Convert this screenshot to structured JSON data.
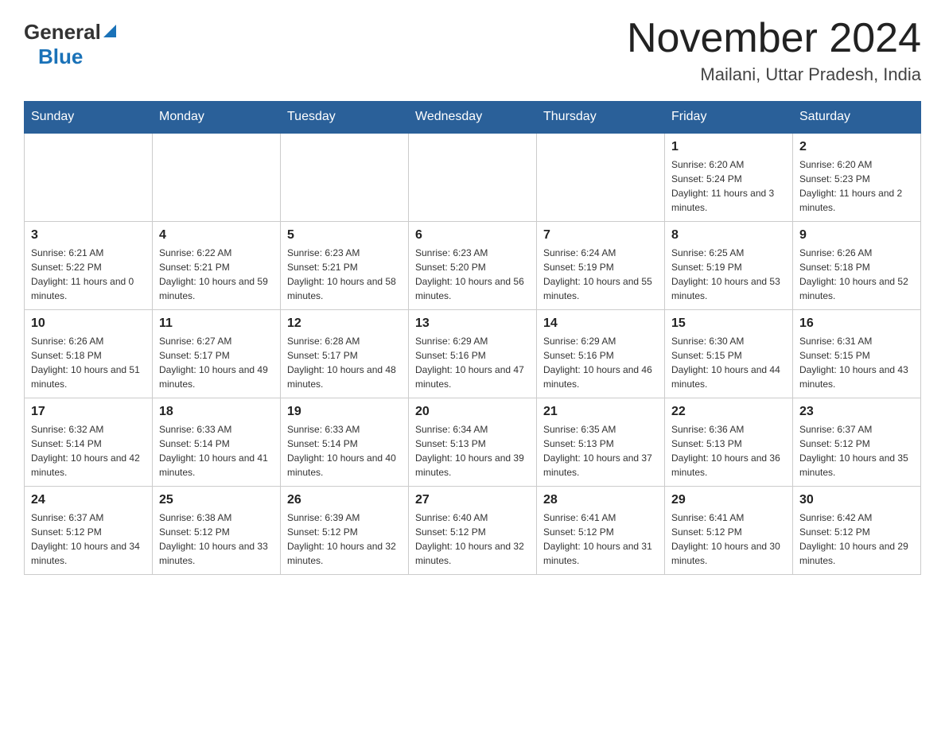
{
  "header": {
    "logo_general": "General",
    "logo_blue": "Blue",
    "title": "November 2024",
    "subtitle": "Mailani, Uttar Pradesh, India"
  },
  "weekdays": [
    "Sunday",
    "Monday",
    "Tuesday",
    "Wednesday",
    "Thursday",
    "Friday",
    "Saturday"
  ],
  "weeks": [
    [
      {
        "day": "",
        "info": ""
      },
      {
        "day": "",
        "info": ""
      },
      {
        "day": "",
        "info": ""
      },
      {
        "day": "",
        "info": ""
      },
      {
        "day": "",
        "info": ""
      },
      {
        "day": "1",
        "info": "Sunrise: 6:20 AM\nSunset: 5:24 PM\nDaylight: 11 hours and 3 minutes."
      },
      {
        "day": "2",
        "info": "Sunrise: 6:20 AM\nSunset: 5:23 PM\nDaylight: 11 hours and 2 minutes."
      }
    ],
    [
      {
        "day": "3",
        "info": "Sunrise: 6:21 AM\nSunset: 5:22 PM\nDaylight: 11 hours and 0 minutes."
      },
      {
        "day": "4",
        "info": "Sunrise: 6:22 AM\nSunset: 5:21 PM\nDaylight: 10 hours and 59 minutes."
      },
      {
        "day": "5",
        "info": "Sunrise: 6:23 AM\nSunset: 5:21 PM\nDaylight: 10 hours and 58 minutes."
      },
      {
        "day": "6",
        "info": "Sunrise: 6:23 AM\nSunset: 5:20 PM\nDaylight: 10 hours and 56 minutes."
      },
      {
        "day": "7",
        "info": "Sunrise: 6:24 AM\nSunset: 5:19 PM\nDaylight: 10 hours and 55 minutes."
      },
      {
        "day": "8",
        "info": "Sunrise: 6:25 AM\nSunset: 5:19 PM\nDaylight: 10 hours and 53 minutes."
      },
      {
        "day": "9",
        "info": "Sunrise: 6:26 AM\nSunset: 5:18 PM\nDaylight: 10 hours and 52 minutes."
      }
    ],
    [
      {
        "day": "10",
        "info": "Sunrise: 6:26 AM\nSunset: 5:18 PM\nDaylight: 10 hours and 51 minutes."
      },
      {
        "day": "11",
        "info": "Sunrise: 6:27 AM\nSunset: 5:17 PM\nDaylight: 10 hours and 49 minutes."
      },
      {
        "day": "12",
        "info": "Sunrise: 6:28 AM\nSunset: 5:17 PM\nDaylight: 10 hours and 48 minutes."
      },
      {
        "day": "13",
        "info": "Sunrise: 6:29 AM\nSunset: 5:16 PM\nDaylight: 10 hours and 47 minutes."
      },
      {
        "day": "14",
        "info": "Sunrise: 6:29 AM\nSunset: 5:16 PM\nDaylight: 10 hours and 46 minutes."
      },
      {
        "day": "15",
        "info": "Sunrise: 6:30 AM\nSunset: 5:15 PM\nDaylight: 10 hours and 44 minutes."
      },
      {
        "day": "16",
        "info": "Sunrise: 6:31 AM\nSunset: 5:15 PM\nDaylight: 10 hours and 43 minutes."
      }
    ],
    [
      {
        "day": "17",
        "info": "Sunrise: 6:32 AM\nSunset: 5:14 PM\nDaylight: 10 hours and 42 minutes."
      },
      {
        "day": "18",
        "info": "Sunrise: 6:33 AM\nSunset: 5:14 PM\nDaylight: 10 hours and 41 minutes."
      },
      {
        "day": "19",
        "info": "Sunrise: 6:33 AM\nSunset: 5:14 PM\nDaylight: 10 hours and 40 minutes."
      },
      {
        "day": "20",
        "info": "Sunrise: 6:34 AM\nSunset: 5:13 PM\nDaylight: 10 hours and 39 minutes."
      },
      {
        "day": "21",
        "info": "Sunrise: 6:35 AM\nSunset: 5:13 PM\nDaylight: 10 hours and 37 minutes."
      },
      {
        "day": "22",
        "info": "Sunrise: 6:36 AM\nSunset: 5:13 PM\nDaylight: 10 hours and 36 minutes."
      },
      {
        "day": "23",
        "info": "Sunrise: 6:37 AM\nSunset: 5:12 PM\nDaylight: 10 hours and 35 minutes."
      }
    ],
    [
      {
        "day": "24",
        "info": "Sunrise: 6:37 AM\nSunset: 5:12 PM\nDaylight: 10 hours and 34 minutes."
      },
      {
        "day": "25",
        "info": "Sunrise: 6:38 AM\nSunset: 5:12 PM\nDaylight: 10 hours and 33 minutes."
      },
      {
        "day": "26",
        "info": "Sunrise: 6:39 AM\nSunset: 5:12 PM\nDaylight: 10 hours and 32 minutes."
      },
      {
        "day": "27",
        "info": "Sunrise: 6:40 AM\nSunset: 5:12 PM\nDaylight: 10 hours and 32 minutes."
      },
      {
        "day": "28",
        "info": "Sunrise: 6:41 AM\nSunset: 5:12 PM\nDaylight: 10 hours and 31 minutes."
      },
      {
        "day": "29",
        "info": "Sunrise: 6:41 AM\nSunset: 5:12 PM\nDaylight: 10 hours and 30 minutes."
      },
      {
        "day": "30",
        "info": "Sunrise: 6:42 AM\nSunset: 5:12 PM\nDaylight: 10 hours and 29 minutes."
      }
    ]
  ]
}
